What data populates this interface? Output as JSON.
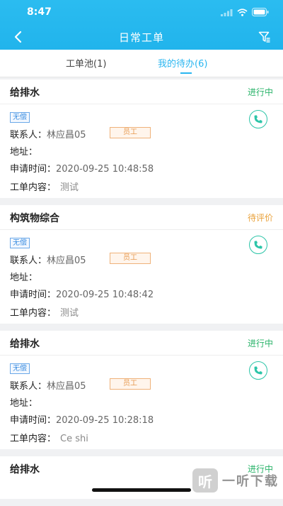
{
  "status_bar": {
    "time": "8:47"
  },
  "nav": {
    "title": "日常工单"
  },
  "tabs": [
    {
      "label": "工单池(1)",
      "active": false
    },
    {
      "label": "我的待办(6)",
      "active": true
    }
  ],
  "colors": {
    "accent": "#29b6f0",
    "status_in_progress": "#2ab36a",
    "status_pending_review": "#e9a23b",
    "phone": "#2cc5a8"
  },
  "orders": [
    {
      "title": "给排水",
      "status": "进行中",
      "status_kind": "in_progress",
      "tag": "无偿",
      "contact_label": "联系人：",
      "contact": "林应昌05",
      "role_tag": "员工",
      "address_label": "地址：",
      "time_label": "申请时间：",
      "time": "2020-09-25 10:48:58",
      "content_label": "工单内容：",
      "content": "测试"
    },
    {
      "title": "构筑物综合",
      "status": "待评价",
      "status_kind": "pending_review",
      "tag": "无偿",
      "contact_label": "联系人：",
      "contact": "林应昌05",
      "role_tag": "员工",
      "address_label": "地址：",
      "time_label": "申请时间：",
      "time": "2020-09-25 10:48:42",
      "content_label": "工单内容：",
      "content": "测试"
    },
    {
      "title": "给排水",
      "status": "进行中",
      "status_kind": "in_progress",
      "tag": "无偿",
      "contact_label": "联系人：",
      "contact": "林应昌05",
      "role_tag": "员工",
      "address_label": "地址：",
      "time_label": "申请时间：",
      "time": "2020-09-25 10:28:18",
      "content_label": "工单内容：",
      "content": "Ce shi"
    },
    {
      "title": "给排水",
      "status": "进行中",
      "status_kind": "in_progress"
    }
  ],
  "watermark": {
    "logo_char": "听",
    "text": "一听下载"
  }
}
